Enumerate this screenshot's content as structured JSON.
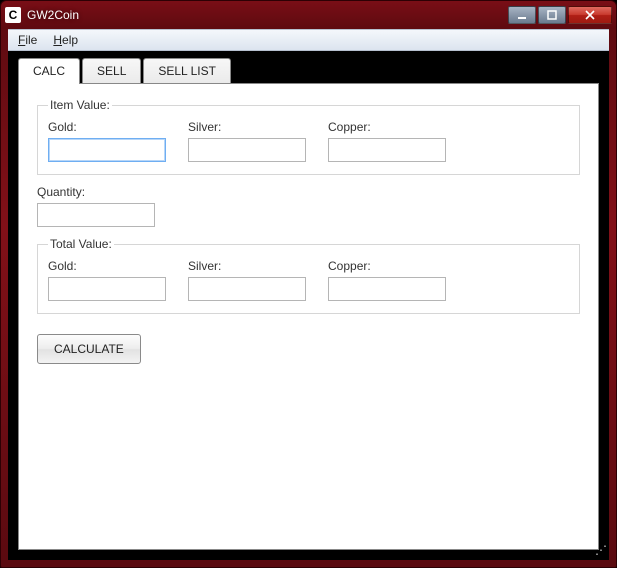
{
  "window": {
    "app_icon_letter": "C",
    "title": "GW2Coin"
  },
  "menus": {
    "file": "File",
    "help": "Help"
  },
  "tabs": {
    "calc": "CALC",
    "sell": "SELL",
    "sell_list": "SELL LIST",
    "active_index": 0
  },
  "groups": {
    "item_value": {
      "legend": "Item Value:",
      "gold_label": "Gold:",
      "silver_label": "Silver:",
      "copper_label": "Copper:",
      "gold_value": "",
      "silver_value": "",
      "copper_value": ""
    },
    "quantity": {
      "label": "Quantity:",
      "value": ""
    },
    "total_value": {
      "legend": "Total Value:",
      "gold_label": "Gold:",
      "silver_label": "Silver:",
      "copper_label": "Copper:",
      "gold_value": "",
      "silver_value": "",
      "copper_value": ""
    }
  },
  "buttons": {
    "calculate": "CALCULATE"
  }
}
